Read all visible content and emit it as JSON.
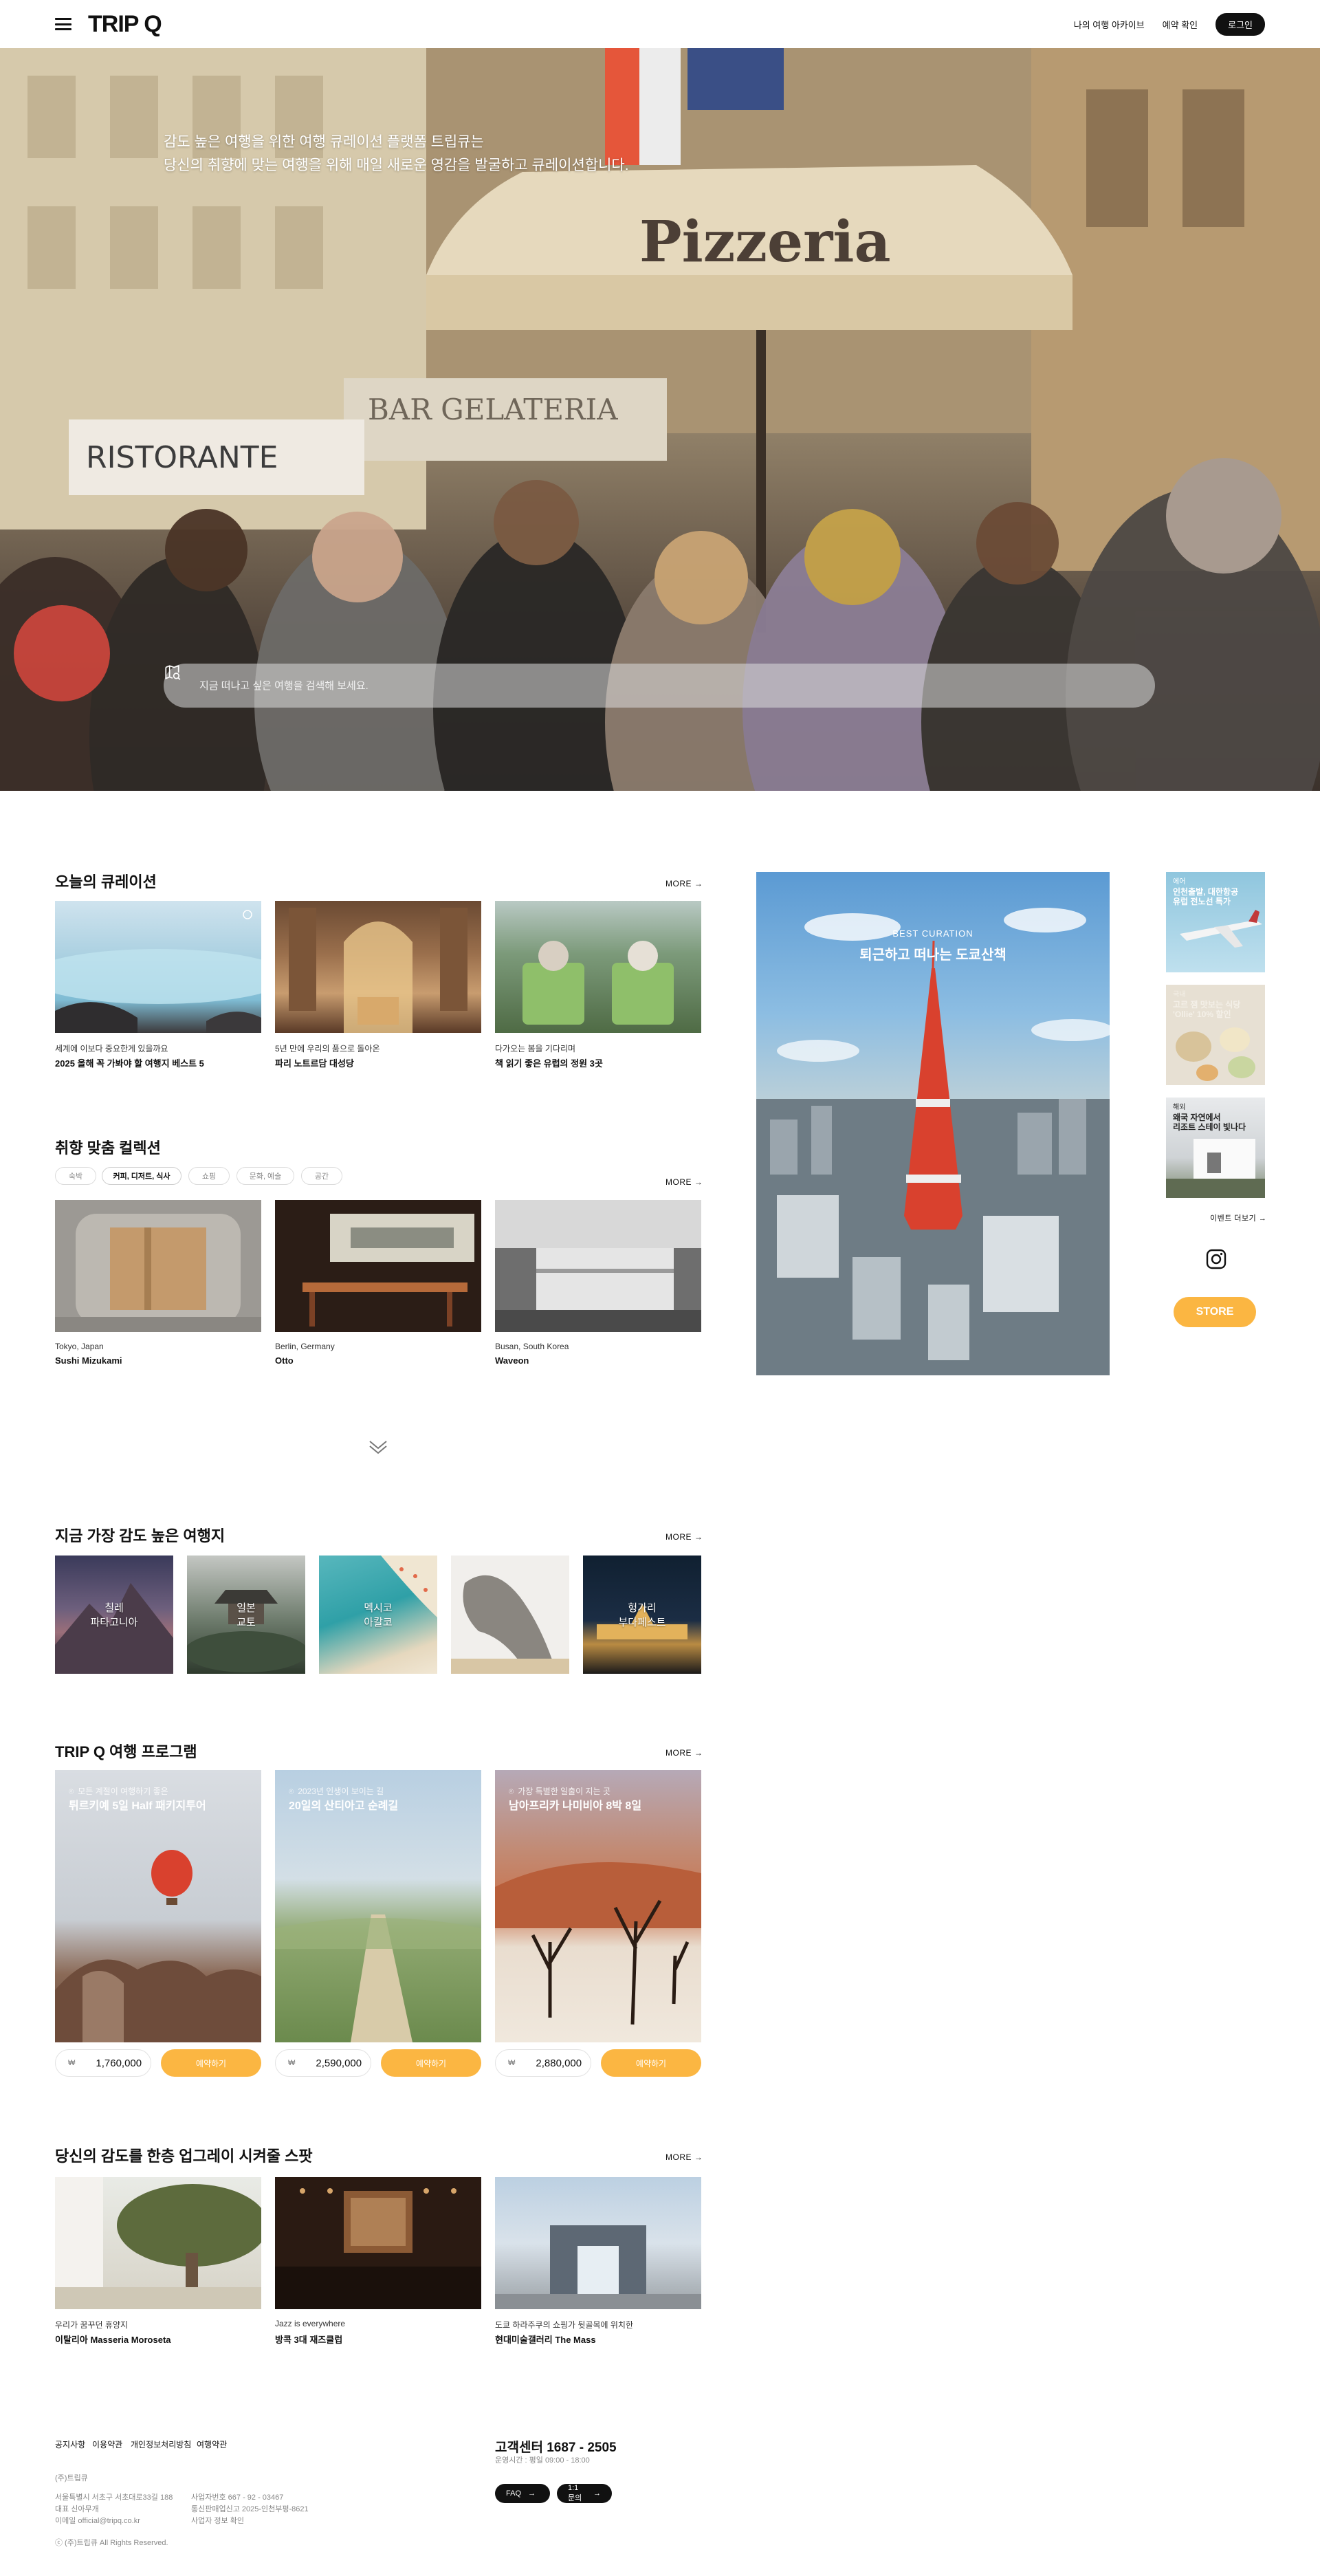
{
  "header": {
    "logo": "TRIP Q",
    "nav": [
      "나의 여행 아카이브",
      "예약 확인"
    ],
    "login": "로그인"
  },
  "hero": {
    "line1": "감도 높은 여행을 위한 여행 큐레이션 플랫폼 트립큐는",
    "line2": "당신의 취향에 맞는 여행을 위해 매일 새로운 영감을 발굴하고 큐레이션합니다.",
    "search_placeholder": "지금 떠나고 싶은 여행을 검색해 보세요.",
    "sign_pizzeria": "Pizzeria",
    "sign_ristorante": "RISTORANTE",
    "sign_gelateria": "BAR GELATERIA"
  },
  "today": {
    "title": "오늘의 큐레이션",
    "more": "MORE",
    "cards": [
      {
        "sub": "세계에 이보다 중요한게 있을까요",
        "title": "2025 올해 꼭 가봐야 할 여행지 베스트 5"
      },
      {
        "sub": "5년 만에 우리의 품으로 돌아온",
        "title": "파리 노트르담 대성당"
      },
      {
        "sub": "다가오는 봄을 기다리며",
        "title": "책 읽기 좋은 유럽의 정원 3곳"
      }
    ]
  },
  "taste": {
    "title": "취향 맞춤 컬렉션",
    "more": "MORE",
    "chips": [
      "숙박",
      "커피, 디저트, 식사",
      "쇼핑",
      "문화, 예술",
      "공간"
    ],
    "cards": [
      {
        "sub": "Tokyo, Japan",
        "title": "Sushi Mizukami"
      },
      {
        "sub": "Berlin, Germany",
        "title": "Otto"
      },
      {
        "sub": "Busan, South Korea",
        "title": "Waveon"
      }
    ]
  },
  "feature": {
    "label": "BEST CURATION",
    "title": "퇴근하고 떠나는 도쿄산책"
  },
  "side": {
    "banners": [
      {
        "small": "에어",
        "text": "인천출발, 대한항공\n유럽 전노선 특가"
      },
      {
        "small": "국내",
        "text": "고르 잼 맛보는 식당\n'Ollie' 10% 할인"
      },
      {
        "small": "해외",
        "text": "왜국 자연에서\n리조트 스테이 빛나다"
      }
    ],
    "events_more": "이벤트 더보기",
    "store": "STORE"
  },
  "destinations": {
    "title": "지금 가장 감도 높은 여행지",
    "more": "MORE",
    "items": [
      {
        "country": "칠레",
        "city": "파타고니아"
      },
      {
        "country": "일본",
        "city": "교토"
      },
      {
        "country": "멕시코",
        "city": "아칼코"
      },
      {
        "country": "",
        "city": ""
      },
      {
        "country": "헝가리",
        "city": "부다페스트"
      }
    ]
  },
  "programs": {
    "title": "TRIP Q 여행 프로그램",
    "more": "MORE",
    "book_label": "예약하기",
    "currency": "₩",
    "items": [
      {
        "sub": "모든 계절이 여행하기 좋은",
        "title": "튀르키예 5일 Half 패키지투어",
        "price": "1,760,000"
      },
      {
        "sub": "2023년 인생이 보이는 길",
        "title": "20일의 산티아고 순례길",
        "price": "2,590,000"
      },
      {
        "sub": "가장 특별한 일출이 지는 곳",
        "title": "남아프리카 나미비아 8박 8일",
        "price": "2,880,000"
      }
    ]
  },
  "upgrade": {
    "title": "당신의 감도를 한층 업그레이 시켜줄 스팟",
    "more": "MORE",
    "cards": [
      {
        "sub": "우리가 꿈꾸던 휴양지",
        "title": "이탈리아 Masseria Moroseta"
      },
      {
        "sub": "Jazz is everywhere",
        "title": "방콕 3대 재즈클럽"
      },
      {
        "sub": "도쿄 하라주쿠의 쇼핑가 뒷골목에 위치한",
        "title": "현대미술갤러리 The Mass"
      }
    ]
  },
  "footer": {
    "links": [
      "공지사항",
      "이용약관",
      "개인정보처리방침",
      "여행약관"
    ],
    "company": "(주)트립큐",
    "info_col1": [
      "서울특별시 서초구 서초대로33길 188",
      "대표 신아무개",
      "이메일 official@tripq.co.kr"
    ],
    "info_col2": [
      "사업자번호 667 - 92 - 03467",
      "통신판매업신고 2025-인천부평-8621",
      "사업자 정보 확인"
    ],
    "copyright": "ⓒ (주)트립큐 All Rights Reserved.",
    "cs_title": "고객센터 1687 - 2505",
    "cs_hours": "운영시간 : 평일 09:00 - 18:00",
    "faq": "FAQ",
    "inquiry": "1:1 문의"
  },
  "colors": {
    "accent": "#fbb642",
    "dark": "#111111"
  }
}
